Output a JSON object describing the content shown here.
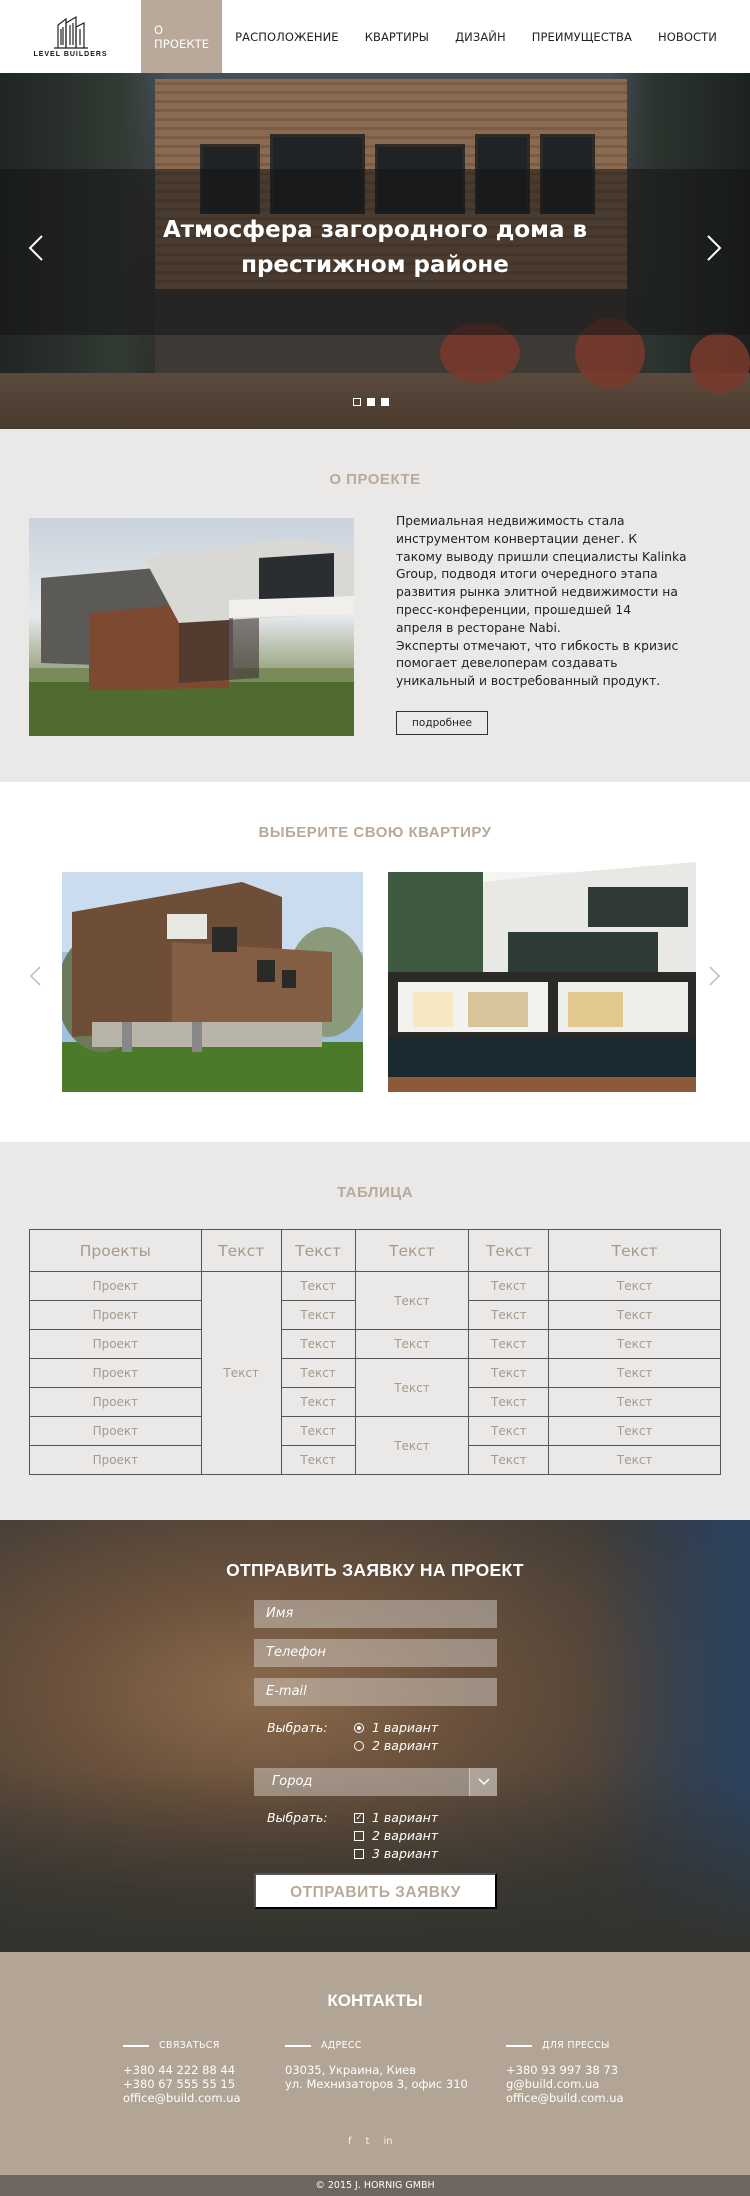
{
  "header": {
    "logo_text": "LEVEL BUILDERS",
    "nav": [
      "О ПРОЕКТЕ",
      "РАСПОЛОЖЕНИЕ",
      "КВАРТИРЫ",
      "ДИЗАЙН",
      "ПРЕИМУЩЕСТВА",
      "НОВОСТИ"
    ],
    "active_index": 0
  },
  "hero": {
    "title_line1": "Атмосфера загородного дома в",
    "title_line2": "престижном районе",
    "prev_icon": "chevron-left-icon",
    "next_icon": "chevron-right-icon",
    "slides_count": 3,
    "active_slide": 1
  },
  "about": {
    "title": "О ПРОЕКТЕ",
    "lines": [
      "Премиальная недвижимость стала",
      "инструментом конвертации денег. К",
      "такому выводу пришли специалисты Kalinka",
      "Group, подводя итоги очередного этапа",
      "развития рынка элитной недвижимости на",
      "пресс-конференции, прошедшей 14",
      "апреля в ресторане Nabi.",
      "Эксперты отмечают, что гибкость в кризис",
      "помогает девелоперам создавать",
      "уникальный и востребованный продукт."
    ],
    "more_button": "подробнее"
  },
  "choose": {
    "title": "ВЫБЕРИТЕ СВОЮ КВАРТИРУ"
  },
  "table": {
    "title": "ТАБЛИЦА",
    "headers": [
      "Проекты",
      "Текст",
      "Текст",
      "Текст",
      "Текст",
      "Текст"
    ],
    "col1": [
      "Проект",
      "Проект",
      "Проект",
      "Проект",
      "Проект",
      "Проект",
      "Проект"
    ],
    "col2_merged": "Текст",
    "col3": [
      "Текст",
      "Текст",
      "Текст",
      "Текст",
      "Текст",
      "Текст",
      "Текст"
    ],
    "col4_groups": [
      "Текст",
      "Текст",
      "Текст",
      "Текст"
    ],
    "col5": [
      "Текст",
      "Текст",
      "Текст",
      "Текст",
      "Текст",
      "Текст",
      "Текст"
    ],
    "col6": [
      "Текст",
      "Текст",
      "Текст",
      "Текст",
      "Текст",
      "Текст",
      "Текст"
    ]
  },
  "form": {
    "title": "ОТПРАВИТЬ ЗАЯВКУ НА ПРОЕКТ",
    "name_placeholder": "Имя",
    "phone_placeholder": "Телефон",
    "email_placeholder": "E-mail",
    "radio_label": "Выбрать:",
    "radio_options": [
      "1 вариант",
      "2 вариант"
    ],
    "radio_selected": 0,
    "city_select": "Город",
    "check_label": "Выбрать:",
    "check_options": [
      "1 вариант",
      "2 вариант",
      "3 вариант"
    ],
    "check_checked": [
      true,
      false,
      false
    ],
    "submit": "ОТПРАВИТЬ ЗАЯВКУ"
  },
  "contacts": {
    "title": "КОНТАКТЫ",
    "col1_head": "СВЯЗАТЬСЯ",
    "col1_lines": [
      "+380 44 222 88 44",
      "+380 67 555 55 15",
      "office@build.com.ua"
    ],
    "col2_head": "АДРЕСС",
    "col2_lines": [
      "03035, Украина, Киев",
      "ул. Мехнизаторов 3, офис 310"
    ],
    "col3_head": "ДЛЯ ПРЕССЫ",
    "col3_lines": [
      "+380 93 997 38 73",
      "g@build.com.ua",
      "office@build.com.ua"
    ],
    "social": [
      "f",
      "t",
      "in"
    ]
  },
  "footer": {
    "copyright": "© 2015 J. HORNIG GMBH"
  },
  "colors": {
    "accent": "#b8a99a",
    "contacts_bg": "#b3a595",
    "footer_bg": "#6e6660",
    "section_bg": "#ebe9e7"
  }
}
